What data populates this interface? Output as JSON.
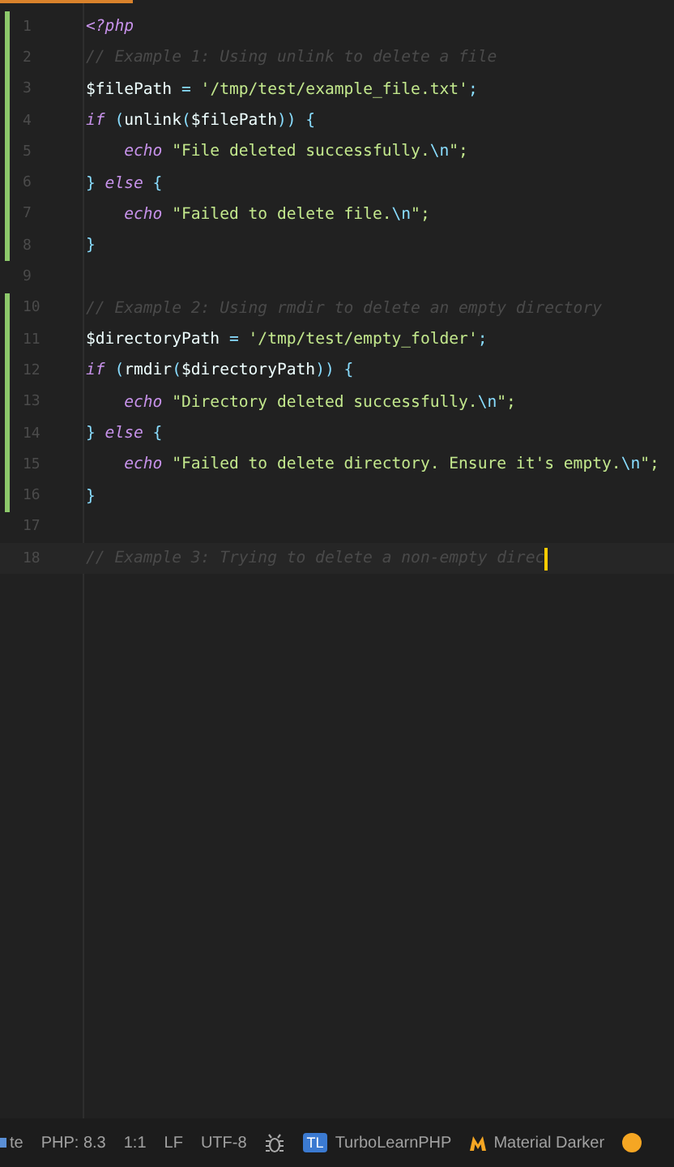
{
  "editor": {
    "lines": [
      {
        "number": "1",
        "changed": true,
        "current": false,
        "tokens": [
          {
            "t": "<?php",
            "kind": "keyword"
          }
        ]
      },
      {
        "number": "2",
        "changed": true,
        "current": false,
        "tokens": [
          {
            "t": "// Example 1: Using unlink to delete a file",
            "kind": "comment"
          }
        ]
      },
      {
        "number": "3",
        "changed": true,
        "current": false,
        "tokens": [
          {
            "t": "$filePath",
            "kind": "var"
          },
          {
            "t": " = ",
            "kind": "punct"
          },
          {
            "t": "'/tmp/test/example_file.txt'",
            "kind": "string"
          },
          {
            "t": ";",
            "kind": "punct"
          }
        ]
      },
      {
        "number": "4",
        "changed": true,
        "current": false,
        "tokens": [
          {
            "t": "if",
            "kind": "keyword"
          },
          {
            "t": " (",
            "kind": "punct"
          },
          {
            "t": "unlink",
            "kind": "func"
          },
          {
            "t": "(",
            "kind": "punct"
          },
          {
            "t": "$filePath",
            "kind": "var"
          },
          {
            "t": ")) {",
            "kind": "punct"
          }
        ]
      },
      {
        "number": "5",
        "changed": true,
        "current": false,
        "tokens": [
          {
            "t": "    echo",
            "kind": "keyword"
          },
          {
            "t": " \"File deleted successfully.",
            "kind": "string"
          },
          {
            "t": "\\n",
            "kind": "escape"
          },
          {
            "t": "\";",
            "kind": "string"
          }
        ]
      },
      {
        "number": "6",
        "changed": true,
        "current": false,
        "tokens": [
          {
            "t": "} ",
            "kind": "punct"
          },
          {
            "t": "else",
            "kind": "keyword"
          },
          {
            "t": " {",
            "kind": "punct"
          }
        ]
      },
      {
        "number": "7",
        "changed": true,
        "current": false,
        "tokens": [
          {
            "t": "    echo",
            "kind": "keyword"
          },
          {
            "t": " \"Failed to delete file.",
            "kind": "string"
          },
          {
            "t": "\\n",
            "kind": "escape"
          },
          {
            "t": "\";",
            "kind": "string"
          }
        ]
      },
      {
        "number": "8",
        "changed": true,
        "current": false,
        "tokens": [
          {
            "t": "}",
            "kind": "punct"
          }
        ]
      },
      {
        "number": "9",
        "changed": false,
        "current": false
      },
      {
        "number": "10",
        "changed": true,
        "current": false,
        "tokens": [
          {
            "t": "// Example 2: Using rmdir to delete an empty directory",
            "kind": "comment"
          }
        ]
      },
      {
        "number": "11",
        "changed": true,
        "current": false,
        "tokens": [
          {
            "t": "$directoryPath",
            "kind": "var"
          },
          {
            "t": " = ",
            "kind": "punct"
          },
          {
            "t": "'/tmp/test/empty_folder'",
            "kind": "string"
          },
          {
            "t": ";",
            "kind": "punct"
          }
        ]
      },
      {
        "number": "12",
        "changed": true,
        "current": false,
        "tokens": [
          {
            "t": "if",
            "kind": "keyword"
          },
          {
            "t": " (",
            "kind": "punct"
          },
          {
            "t": "rmdir",
            "kind": "func"
          },
          {
            "t": "(",
            "kind": "punct"
          },
          {
            "t": "$directoryPath",
            "kind": "var"
          },
          {
            "t": ")) {",
            "kind": "punct"
          }
        ]
      },
      {
        "number": "13",
        "changed": true,
        "current": false,
        "tokens": [
          {
            "t": "    echo",
            "kind": "keyword"
          },
          {
            "t": " \"Directory deleted successfully.",
            "kind": "string"
          },
          {
            "t": "\\n",
            "kind": "escape"
          },
          {
            "t": "\";",
            "kind": "string"
          }
        ]
      },
      {
        "number": "14",
        "changed": true,
        "current": false,
        "tokens": [
          {
            "t": "} ",
            "kind": "punct"
          },
          {
            "t": "else",
            "kind": "keyword"
          },
          {
            "t": " {",
            "kind": "punct"
          }
        ]
      },
      {
        "number": "15",
        "changed": true,
        "current": false,
        "tokens": [
          {
            "t": "    echo",
            "kind": "keyword"
          },
          {
            "t": " \"Failed to delete directory. Ensure it's empty.",
            "kind": "string"
          },
          {
            "t": "\\n",
            "kind": "escape"
          },
          {
            "t": "\";",
            "kind": "string"
          }
        ]
      },
      {
        "number": "16",
        "changed": true,
        "current": false,
        "tokens": [
          {
            "t": "}",
            "kind": "punct"
          }
        ]
      },
      {
        "number": "17",
        "changed": false,
        "current": false
      },
      {
        "number": "18",
        "changed": false,
        "current": true,
        "tokens": [
          {
            "t": "// Example 3: Trying to delete a non-empty direc",
            "kind": "comment"
          }
        ]
      }
    ]
  },
  "status_bar": {
    "cut_item": "te",
    "language": "PHP: 8.3",
    "position": "1:1",
    "line_ending": "LF",
    "encoding": "UTF-8",
    "project_badge": "TL",
    "project": "TurboLearnPHP",
    "theme": "Material Darker"
  }
}
